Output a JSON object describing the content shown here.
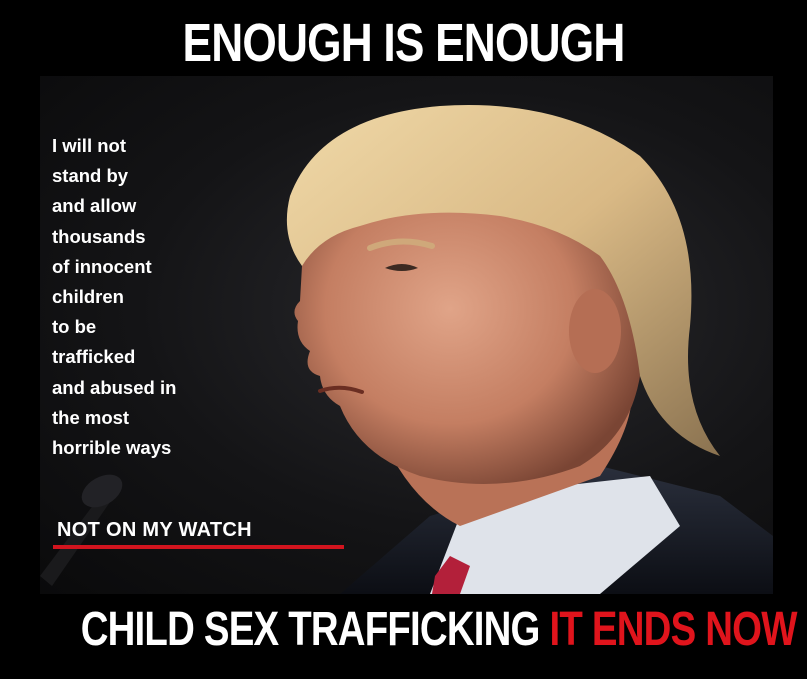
{
  "headline": "ENOUGH IS ENOUGH",
  "quote_lines": [
    "I will not",
    "stand by",
    "and allow",
    "thousands",
    "of innocent",
    "children",
    "to be",
    "trafficked",
    "and abused in",
    "the most",
    "horrible ways"
  ],
  "tagline": "NOT ON MY WATCH",
  "footer": {
    "white_part": "CHILD SEX TRAFFICKING",
    "red_part": "IT ENDS NOW"
  },
  "colors": {
    "background": "#000000",
    "text": "#ffffff",
    "accent_red": "#e0141c"
  }
}
